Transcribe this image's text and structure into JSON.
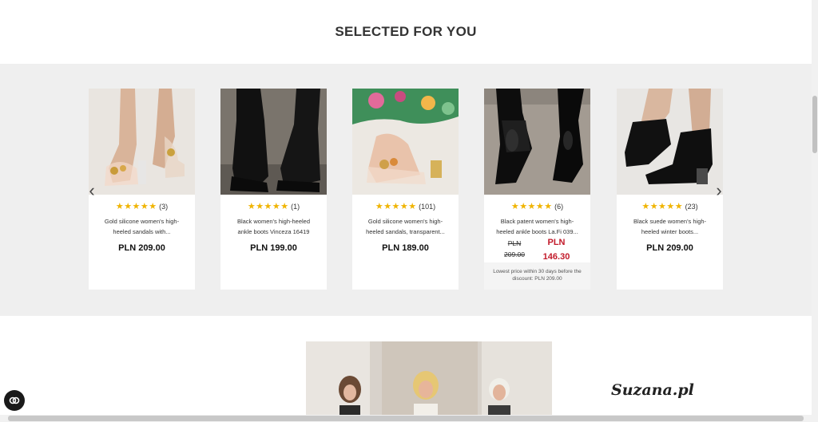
{
  "section": {
    "title": "SELECTED FOR YOU"
  },
  "carousel": {
    "prev_symbol": "‹",
    "next_symbol": "›",
    "products": [
      {
        "stars": "★★★★★",
        "reviews": "(3)",
        "name": "Gold silicone women's high-heeled sandals with...",
        "price": "PLN 209.00"
      },
      {
        "stars": "★★★★★",
        "reviews": "(1)",
        "name": "Black women's high-heeled ankle boots Vinceza 16419",
        "price": "PLN 199.00"
      },
      {
        "stars": "★★★★★",
        "reviews": "(101)",
        "name": "Gold silicone women's high-heeled sandals, transparent...",
        "price": "PLN 189.00"
      },
      {
        "stars": "★★★★★",
        "reviews": "(6)",
        "name": "Black patent women's high-heeled ankle boots La.Fi 039...",
        "old_price": "PLN 209.00",
        "new_price": "PLN 146.30",
        "lowest_note": "Lowest price within 30 days before the discount: PLN 209.00"
      },
      {
        "stars": "★★★★★",
        "reviews": "(23)",
        "name": "Black suede women's high-heeled winter boots...",
        "price": "PLN 209.00"
      }
    ]
  },
  "brand": {
    "logo_text": "Suzana.pl"
  },
  "colors": {
    "star": "#f0b400",
    "sale": "#c21a2a",
    "band": "#efefef"
  }
}
